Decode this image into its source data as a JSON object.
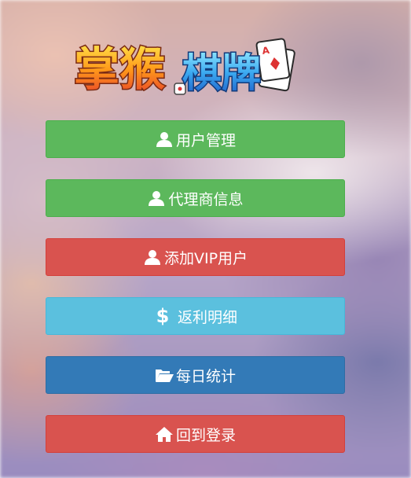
{
  "logo": {
    "text": "掌猴棋牌"
  },
  "menu": {
    "items": [
      {
        "label": "用户管理",
        "icon": "user-icon",
        "color": "#5cb85c"
      },
      {
        "label": "代理商信息",
        "icon": "user-icon",
        "color": "#5cb85c"
      },
      {
        "label": "添加VIP用户",
        "icon": "user-icon",
        "color": "#d9534f"
      },
      {
        "label": "返利明细",
        "icon": "dollar-icon",
        "color": "#5bc0de",
        "glyph": "$"
      },
      {
        "label": "每日统计",
        "icon": "folder-open-icon",
        "color": "#337ab7"
      },
      {
        "label": "回到登录",
        "icon": "home-icon",
        "color": "#d9534f"
      }
    ]
  }
}
